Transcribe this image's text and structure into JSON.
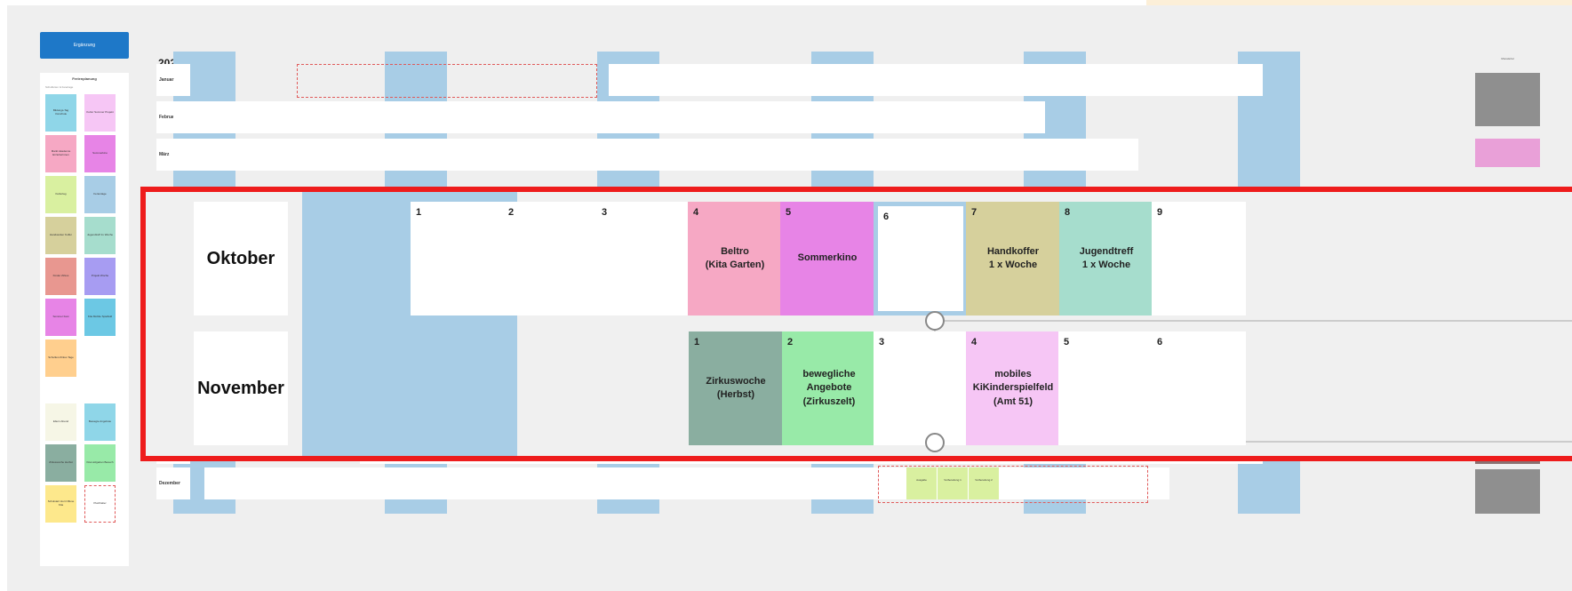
{
  "toolbar": {
    "primary_button": "Ergänzung"
  },
  "legend": {
    "title": "Ferienplanung",
    "section1": "Schulferien & Feiertage",
    "section2": "Termine offen",
    "items": [
      {
        "label": "Bildungs-Tag Vorschule",
        "color": "#8fd6e8"
      },
      {
        "label": "Kultur Sommer Projekt",
        "color": "#f6c6f5"
      },
      {
        "label": "Markt Akademie Erzieherinnen",
        "color": "#f6a8c4"
      },
      {
        "label": "Sommerkino",
        "color": "#e784e6"
      },
      {
        "label": "Kulturtag",
        "color": "#d9f0a0"
      },
      {
        "label": "Ferientage",
        "color": "#a8cde6"
      },
      {
        "label": "Handwerker Koffer",
        "color": "#d6d09c"
      },
      {
        "label": "Jugendtreff 1x Woche",
        "color": "#a6ddcd"
      },
      {
        "label": "Kinder Zirkus",
        "color": "#e89790"
      },
      {
        "label": "Projekt Woche",
        "color": "#a79cf2"
      },
      {
        "label": "Sommer Fest",
        "color": "#e784e6"
      },
      {
        "label": "Kita Mobile Spielfeld",
        "color": "#6cc8e4"
      },
      {
        "label": "Schulfest Zirkus Tage",
        "color": "#ffcf8e"
      },
      {
        "label": "Eltern Abend",
        "color": "#f6f6e6"
      },
      {
        "label": "Bewegte Angebote",
        "color": "#8fd6e8"
      },
      {
        "label": "Zirkuswoche Herbst",
        "color": "#8aaea0"
      },
      {
        "label": "Kita Hofgarten Besuch",
        "color": "#98eaa8"
      },
      {
        "label": "Schulstart Hort Offene Kita",
        "color": "#fde88c"
      },
      {
        "label": "Platzhalter",
        "color": "#ffffff"
      }
    ]
  },
  "calendar": {
    "year": "2025",
    "months": [
      "Januar",
      "Februar",
      "März",
      "Oktober",
      "November",
      "Dezember"
    ],
    "right_column_title": "Monatsziel",
    "december_tags": [
      "Ausgabe",
      "Vorbereitung 1",
      "Vorbereitung 2"
    ]
  },
  "zoom": {
    "rows": [
      {
        "month": "Oktober",
        "cells": [
          {
            "num": "1",
            "text": "",
            "color": "#ffffff"
          },
          {
            "num": "2",
            "text": "",
            "color": "#ffffff"
          },
          {
            "num": "3",
            "text": "",
            "color": "#ffffff"
          },
          {
            "num": "4",
            "text": "Beltro\n(Kita Garten)",
            "color": "#f6a8c4"
          },
          {
            "num": "5",
            "text": "Sommerkino",
            "color": "#e784e6"
          },
          {
            "num": "6",
            "text": "",
            "color": "#ffffff",
            "outline": true
          },
          {
            "num": "7",
            "text": "Handkoffer\n1 x Woche",
            "color": "#d6d09c"
          },
          {
            "num": "8",
            "text": "Jugendtreff\n1 x Woche",
            "color": "#a6ddcd"
          },
          {
            "num": "9",
            "text": "",
            "color": "#ffffff"
          }
        ]
      },
      {
        "month": "November",
        "cells": [
          {
            "num": "1",
            "text": "Zirkuswoche\n(Herbst)",
            "color": "#8aaea0"
          },
          {
            "num": "2",
            "text": "bewegliche\nAngebote\n(Zirkuszelt)",
            "color": "#98eaa8"
          },
          {
            "num": "3",
            "text": "",
            "color": "#ffffff"
          },
          {
            "num": "4",
            "text": "mobiles\nKiKinderspielfeld\n(Amt 51)",
            "color": "#f6c6f5"
          },
          {
            "num": "5",
            "text": "",
            "color": "#ffffff"
          },
          {
            "num": "6",
            "text": "",
            "color": "#ffffff"
          }
        ]
      }
    ]
  }
}
